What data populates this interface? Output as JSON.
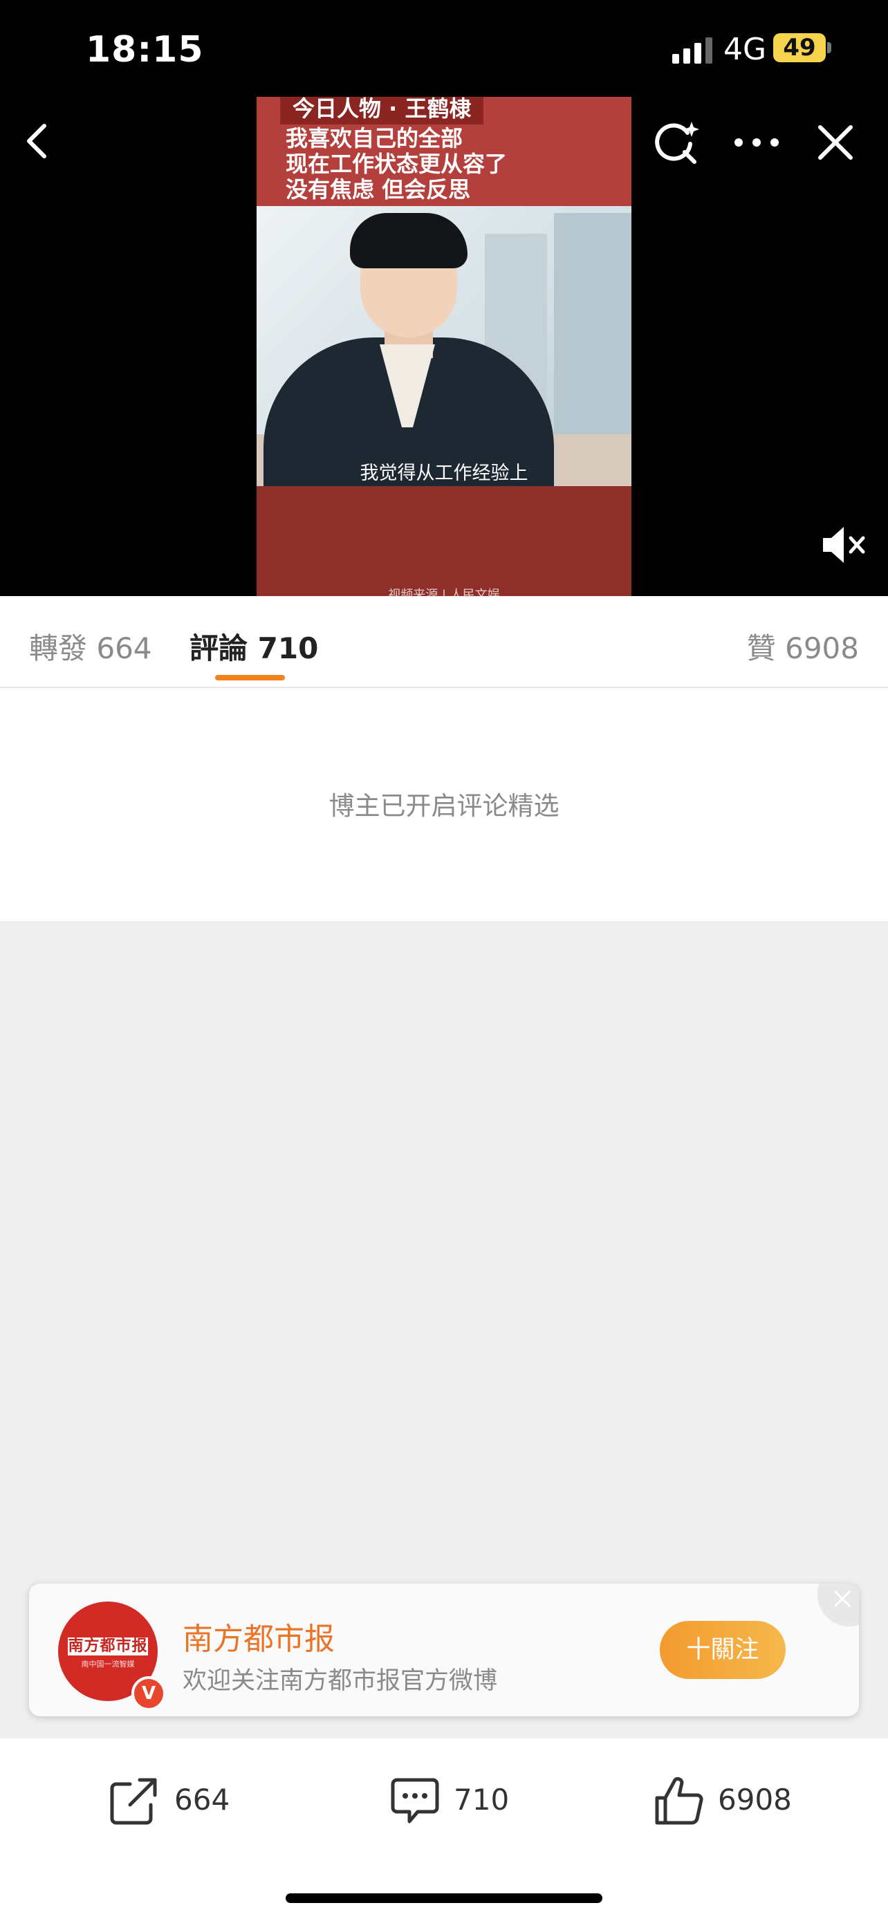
{
  "status_bar": {
    "time": "18:15",
    "network": "4G",
    "battery": "49"
  },
  "video": {
    "tag": "今日人物 · 王鹤棣",
    "headline": [
      "我喜欢自己的全部",
      "现在工作状态更从容了",
      "没有焦虑 但会反思"
    ],
    "subtitle": "我觉得从工作经验上",
    "source": "视频来源 | 人民文娱"
  },
  "tabs": {
    "repost": "轉發 664",
    "comment": "評論 710",
    "like": "贊 6908"
  },
  "notice": "博主已开启评论精选",
  "follow_card": {
    "avatar_logo": "南方都市报",
    "avatar_motto": "南中国一流智媒",
    "verified_badge": "V",
    "name": "南方都市报",
    "description": "欢迎关注南方都市报官方微博",
    "follow_label": "十關注"
  },
  "actions": {
    "repost_count": "664",
    "comment_count": "710",
    "like_count": "6908"
  },
  "colors": {
    "accent": "#f2831f",
    "brand_red": "#d22a24",
    "follow_gradient": "#f39a2e"
  }
}
